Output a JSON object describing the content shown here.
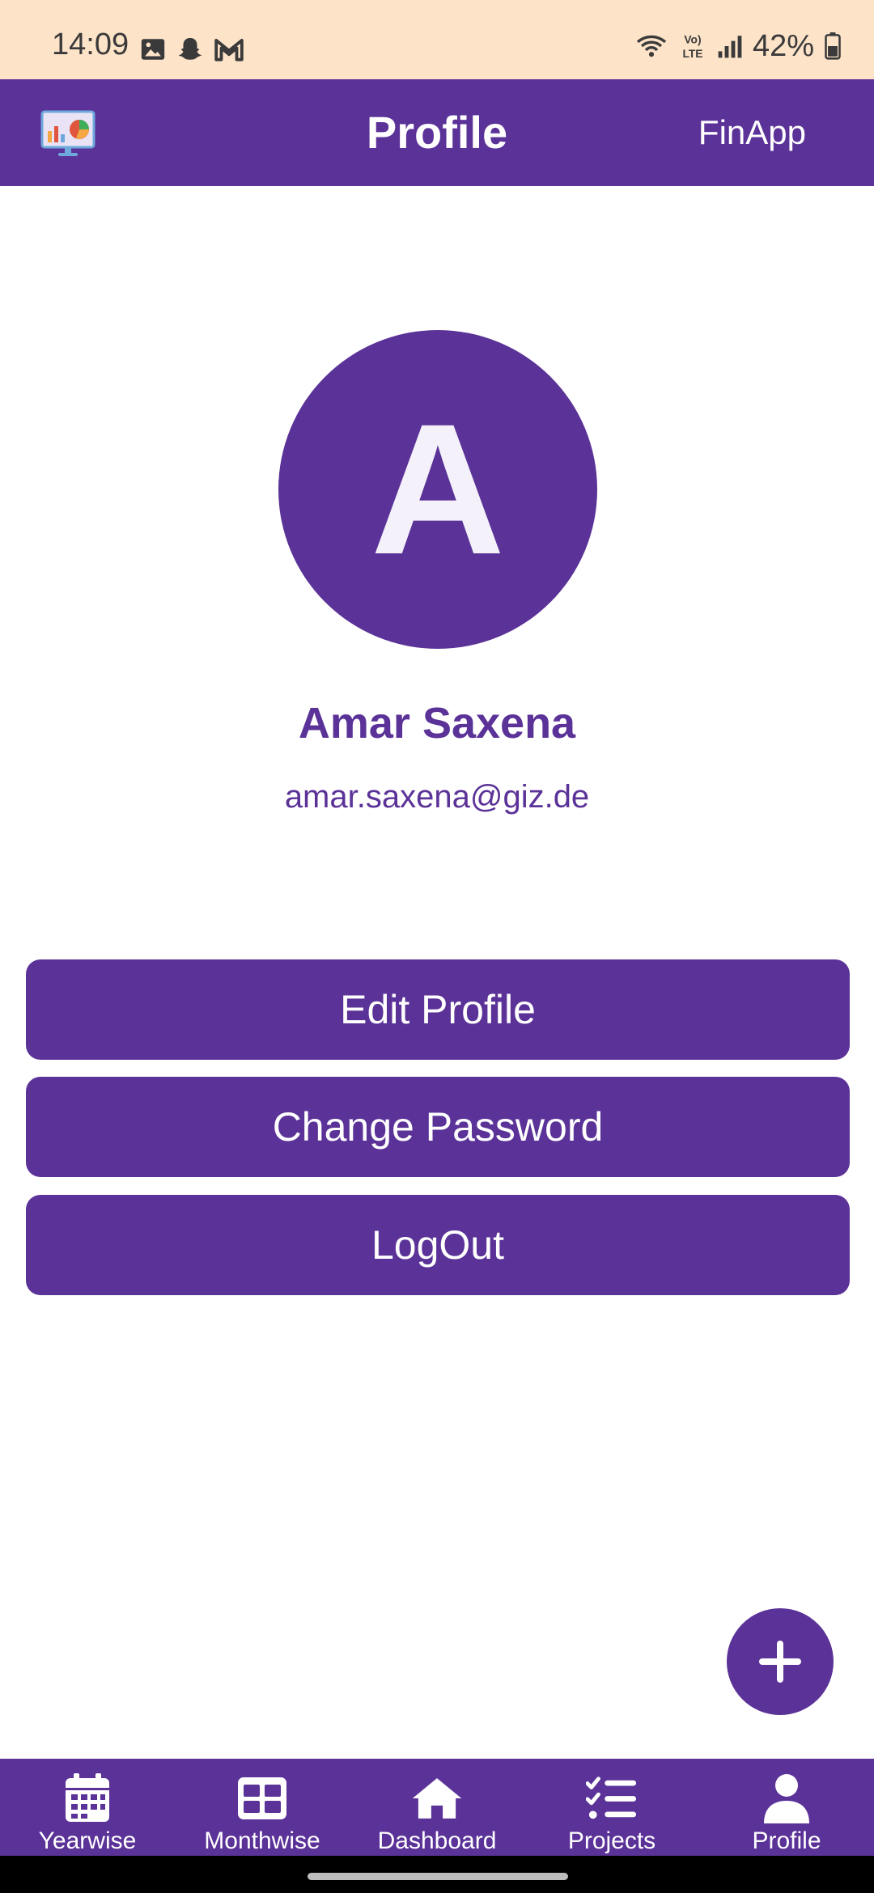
{
  "status_bar": {
    "time": "14:09",
    "battery": "42%",
    "icons": [
      "gallery-icon",
      "snapchat-icon",
      "gmail-icon",
      "wifi-icon",
      "volte-icon",
      "signal-icon",
      "battery-icon"
    ]
  },
  "app_bar": {
    "title": "Profile",
    "app_name": "FinApp",
    "logo_icon": "presentation-chart-icon"
  },
  "profile": {
    "avatar_letter": "A",
    "name": "Amar Saxena",
    "email": "amar.saxena@giz.de"
  },
  "actions": {
    "edit_profile": "Edit Profile",
    "change_password": "Change Password",
    "logout": "LogOut"
  },
  "fab": {
    "icon": "plus-icon"
  },
  "bottom_nav": {
    "items": [
      {
        "label": "Yearwise",
        "icon": "calendar-icon"
      },
      {
        "label": "Monthwise",
        "icon": "table-icon"
      },
      {
        "label": "Dashboard",
        "icon": "home-icon"
      },
      {
        "label": "Projects",
        "icon": "checklist-icon"
      },
      {
        "label": "Profile",
        "icon": "user-icon"
      }
    ]
  },
  "colors": {
    "primary": "#5b3298",
    "status_bar_bg": "#fde3c8",
    "text_on_primary": "#ffffff"
  }
}
